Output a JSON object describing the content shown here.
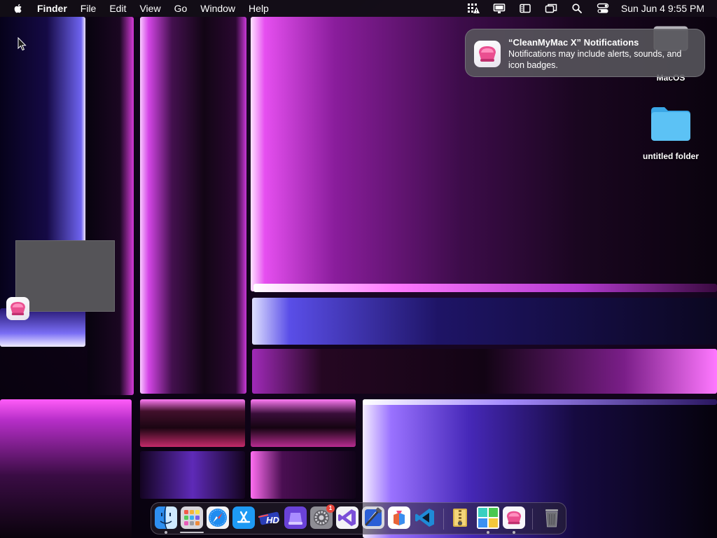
{
  "menubar": {
    "apple_icon": "apple-logo-icon",
    "app_name": "Finder",
    "menus": [
      "File",
      "Edit",
      "View",
      "Go",
      "Window",
      "Help"
    ],
    "status_icons": [
      "grid-alert-icon",
      "display-icon",
      "sidebar-icon",
      "windows-icon",
      "search-icon",
      "control-center-icon"
    ],
    "clock": "Sun Jun 4  9:55 PM"
  },
  "notification": {
    "title": "“CleanMyMac X” Notifications",
    "body": "Notifications may include alerts, sounds, and icon badges."
  },
  "desktop": {
    "drive_label": "MacOS",
    "folder_label": "untitled folder"
  },
  "dock": {
    "items": [
      {
        "name": "finder-icon",
        "running": true
      },
      {
        "name": "launchpad-icon",
        "running": false
      },
      {
        "name": "safari-icon",
        "running": false
      },
      {
        "name": "app-store-icon",
        "running": false
      },
      {
        "name": "hp-icon",
        "running": false
      },
      {
        "name": "stack-app-icon",
        "running": false
      },
      {
        "name": "system-settings-icon",
        "running": false,
        "badge": "1"
      },
      {
        "name": "visual-studio-icon",
        "running": false
      },
      {
        "name": "xcode-icon",
        "running": false
      },
      {
        "name": "gift-app-icon",
        "running": false
      },
      {
        "name": "vscode-icon",
        "running": false
      },
      {
        "name": "archive-utility-icon",
        "running": false
      },
      {
        "name": "color-grid-app-icon",
        "running": true
      },
      {
        "name": "cleanmymac-icon",
        "running": true
      },
      {
        "name": "trash-icon",
        "running": false
      }
    ]
  },
  "colors": {
    "menubar_bg": "#120e16",
    "wallpaper_pink": "#e040e8",
    "wallpaper_purple": "#6a3ad8",
    "folder_blue": "#4fb8f0",
    "notification_bg": "#58565c",
    "badge_red": "#e8453c"
  }
}
